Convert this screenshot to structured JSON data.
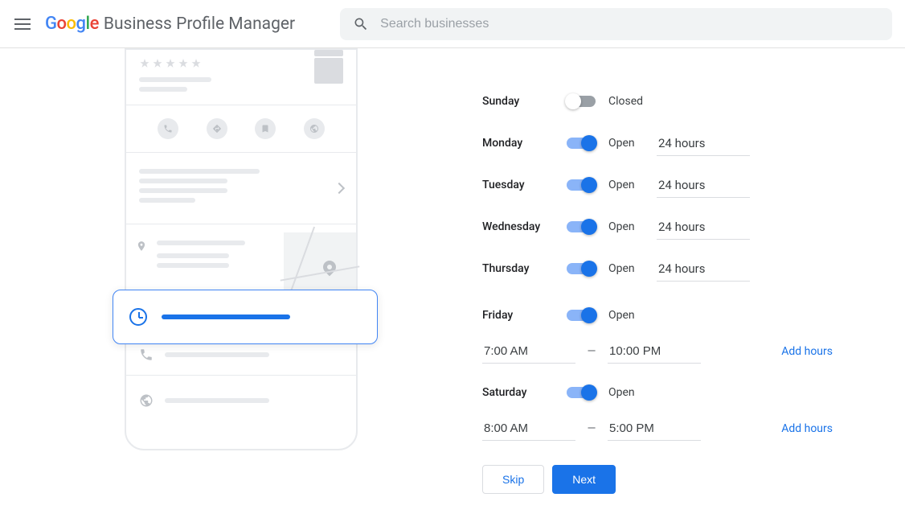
{
  "header": {
    "product_name": "Business Profile Manager",
    "search_placeholder": "Search businesses"
  },
  "hours": {
    "status_open": "Open",
    "status_closed": "Closed",
    "add_hours_label": "Add hours",
    "days": [
      {
        "name": "Sunday",
        "open": false,
        "value": ""
      },
      {
        "name": "Monday",
        "open": true,
        "value": "24 hours"
      },
      {
        "name": "Tuesday",
        "open": true,
        "value": "24 hours"
      },
      {
        "name": "Wednesday",
        "open": true,
        "value": "24 hours"
      },
      {
        "name": "Thursday",
        "open": true,
        "value": "24 hours"
      },
      {
        "name": "Friday",
        "open": true,
        "from": "7:00 AM",
        "to": "10:00 PM"
      },
      {
        "name": "Saturday",
        "open": true,
        "from": "8:00 AM",
        "to": "5:00 PM"
      }
    ]
  },
  "actions": {
    "skip": "Skip",
    "next": "Next"
  }
}
